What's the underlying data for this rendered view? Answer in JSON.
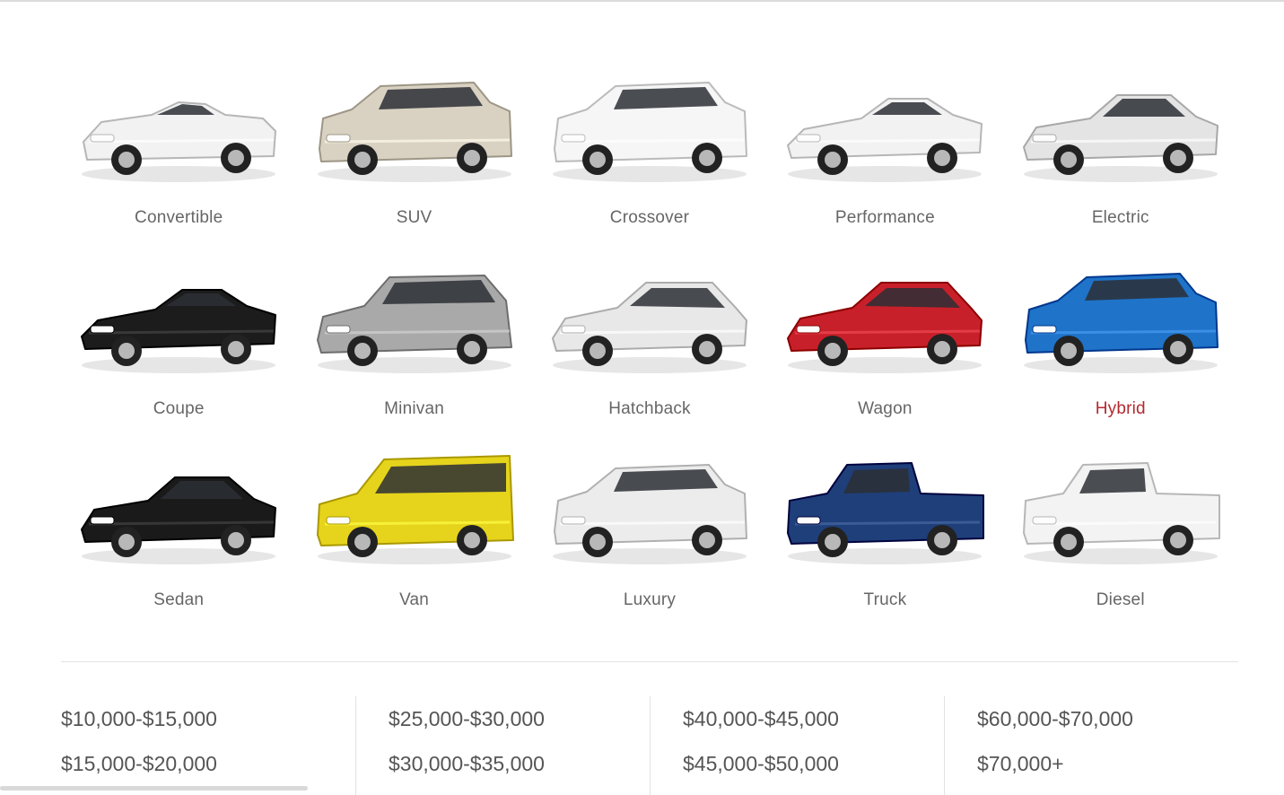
{
  "body_styles": [
    {
      "label": "Convertible",
      "icon": "convertible-car-icon",
      "color": "#f2f2f2",
      "shape": "conv"
    },
    {
      "label": "SUV",
      "icon": "suv-car-icon",
      "color": "#d9d2c2",
      "shape": "suv"
    },
    {
      "label": "Crossover",
      "icon": "crossover-car-icon",
      "color": "#f6f6f6",
      "shape": "suv"
    },
    {
      "label": "Performance",
      "icon": "performance-car-icon",
      "color": "#f2f2f2",
      "shape": "sport"
    },
    {
      "label": "Electric",
      "icon": "electric-car-icon",
      "color": "#e4e4e4",
      "shape": "sedan"
    },
    {
      "label": "Coupe",
      "icon": "coupe-car-icon",
      "color": "#1c1c1c",
      "shape": "sport"
    },
    {
      "label": "Minivan",
      "icon": "minivan-car-icon",
      "color": "#a9a9a9",
      "shape": "van"
    },
    {
      "label": "Hatchback",
      "icon": "hatchback-car-icon",
      "color": "#e8e8e8",
      "shape": "hatch"
    },
    {
      "label": "Wagon",
      "icon": "wagon-car-icon",
      "color": "#c8202a",
      "shape": "hatch"
    },
    {
      "label": "Hybrid",
      "icon": "hybrid-car-icon",
      "color": "#1f73c9",
      "shape": "suv",
      "active": true
    },
    {
      "label": "Sedan",
      "icon": "sedan-car-icon",
      "color": "#1a1a1a",
      "shape": "sedan"
    },
    {
      "label": "Van",
      "icon": "van-car-icon",
      "color": "#e6d41c",
      "shape": "bigvan"
    },
    {
      "label": "Luxury",
      "icon": "luxury-car-icon",
      "color": "#ececec",
      "shape": "suv"
    },
    {
      "label": "Truck",
      "icon": "truck-car-icon",
      "color": "#1f3f7a",
      "shape": "truck"
    },
    {
      "label": "Diesel",
      "icon": "diesel-car-icon",
      "color": "#f3f3f3",
      "shape": "truck"
    }
  ],
  "accent_color": "#b5282e",
  "price_ranges": [
    [
      "$10,000-$15,000",
      "$15,000-$20,000"
    ],
    [
      "$25,000-$30,000",
      "$30,000-$35,000"
    ],
    [
      "$40,000-$45,000",
      "$45,000-$50,000"
    ],
    [
      "$60,000-$70,000",
      "$70,000+"
    ]
  ]
}
